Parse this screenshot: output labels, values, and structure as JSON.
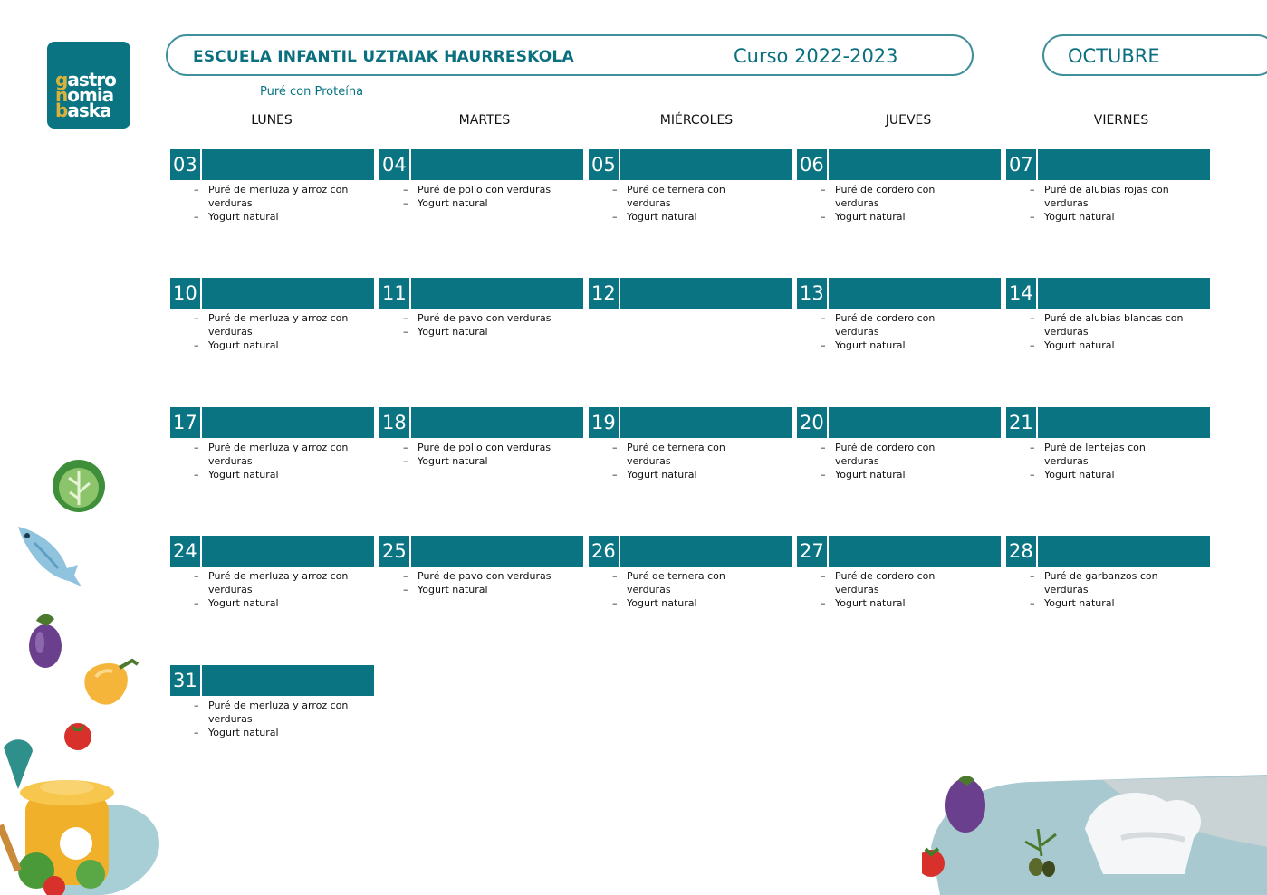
{
  "logo": {
    "lines": [
      [
        "g",
        "astro"
      ],
      [
        "n",
        "omia"
      ],
      [
        "b",
        "aska"
      ]
    ]
  },
  "header": {
    "school": "ESCUELA INFANTIL UZTAIAK HAURRESKOLA",
    "course": "Curso 2022-2023",
    "month": "OCTUBRE"
  },
  "legend": "Puré con Proteína",
  "weekdays": [
    "LUNES",
    "MARTES",
    "MIÉRCOLES",
    "JUEVES",
    "VIERNES"
  ],
  "weeks": [
    [
      {
        "num": "03",
        "items": [
          "Puré de merluza y arroz con verduras",
          "Yogurt natural"
        ]
      },
      {
        "num": "04",
        "items": [
          "Puré de pollo con verduras",
          "Yogurt natural"
        ]
      },
      {
        "num": "05",
        "items": [
          "Puré de ternera con verduras",
          "Yogurt natural"
        ]
      },
      {
        "num": "06",
        "items": [
          "Puré de cordero con verduras",
          "Yogurt natural"
        ]
      },
      {
        "num": "07",
        "items": [
          "Puré de alubias rojas con verduras",
          "Yogurt natural"
        ]
      }
    ],
    [
      {
        "num": "10",
        "items": [
          "Puré de merluza y arroz con verduras",
          "Yogurt natural"
        ]
      },
      {
        "num": "11",
        "items": [
          "Puré de pavo con verduras",
          "Yogurt natural"
        ]
      },
      {
        "num": "12",
        "items": []
      },
      {
        "num": "13",
        "items": [
          "Puré de cordero con verduras",
          "Yogurt natural"
        ]
      },
      {
        "num": "14",
        "items": [
          "Puré de alubias blancas con verduras",
          "Yogurt natural"
        ]
      }
    ],
    [
      {
        "num": "17",
        "items": [
          "Puré de merluza y arroz con verduras",
          "Yogurt natural"
        ]
      },
      {
        "num": "18",
        "items": [
          "Puré de pollo con verduras",
          "Yogurt natural"
        ]
      },
      {
        "num": "19",
        "items": [
          "Puré de ternera con verduras",
          "Yogurt natural"
        ]
      },
      {
        "num": "20",
        "items": [
          "Puré de cordero con verduras",
          "Yogurt natural"
        ]
      },
      {
        "num": "21",
        "items": [
          "Puré de lentejas con verduras",
          "Yogurt natural"
        ]
      }
    ],
    [
      {
        "num": "24",
        "items": [
          "Puré de merluza y arroz con verduras",
          "Yogurt natural"
        ]
      },
      {
        "num": "25",
        "items": [
          "Puré de pavo con verduras",
          "Yogurt natural"
        ]
      },
      {
        "num": "26",
        "items": [
          "Puré de ternera con verduras",
          "Yogurt natural"
        ]
      },
      {
        "num": "27",
        "items": [
          "Puré de cordero con verduras",
          "Yogurt natural"
        ]
      },
      {
        "num": "28",
        "items": [
          "Puré de garbanzos con verduras",
          "Yogurt natural"
        ]
      }
    ],
    [
      {
        "num": "31",
        "items": [
          "Puré de merluza y arroz con verduras",
          "Yogurt natural"
        ]
      }
    ]
  ],
  "colors": {
    "brand": "#0a7483",
    "logo_accent": "#d9b23a"
  },
  "decorations": [
    "lettuce-icon",
    "fish-icon",
    "eggplant-icon",
    "pepper-icon",
    "tomato-icon",
    "cooking-pot-icon",
    "chef-hat-icon",
    "olive-icon"
  ]
}
